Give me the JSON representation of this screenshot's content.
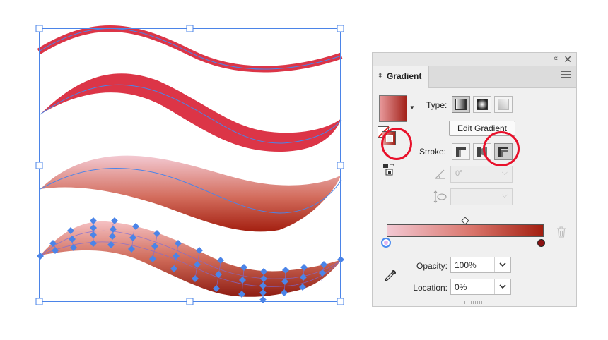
{
  "panel": {
    "title": "Gradient",
    "collapse_glyph": "«",
    "close_glyph": "✕",
    "tab_arrows_glyph": "⬍",
    "type_label": "Type:",
    "edit_button_label": "Edit Gradient",
    "stroke_label": "Stroke:",
    "angle_value": "0°",
    "opacity_label": "Opacity:",
    "opacity_value": "100%",
    "location_label": "Location:",
    "location_value": "0%",
    "type_options": [
      "linear-gradient-icon",
      "radial-gradient-icon",
      "freeform-gradient-icon"
    ],
    "selected_type": "linear-gradient-icon",
    "stroke_options": [
      "stroke-within-icon",
      "stroke-along-icon",
      "stroke-across-icon"
    ],
    "selected_stroke": "stroke-across-icon"
  },
  "colors": {
    "solid_red": "#dc3547",
    "gradient_start": "#f1c6cf",
    "gradient_end": "#a31f10",
    "selection_blue": "#4b84e8",
    "annotation_red": "#e8102a"
  }
}
